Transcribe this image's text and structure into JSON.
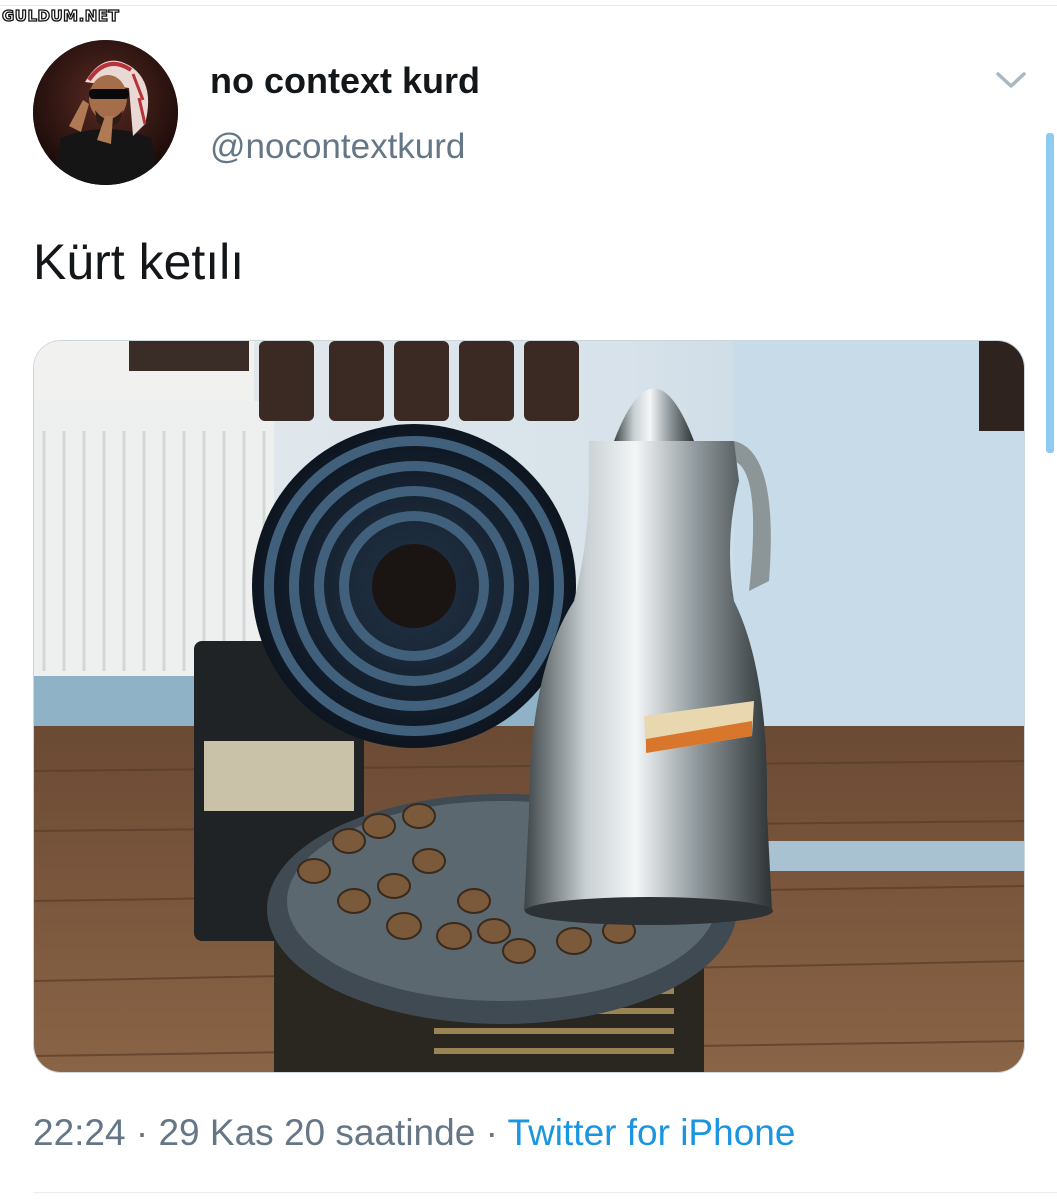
{
  "watermark": "GULDUM.NET",
  "tweet": {
    "display_name": "no context kurd",
    "handle": "@nocontextkurd",
    "text": "Kürt ketılı",
    "time": "22:24",
    "date": "29 Kas 20 saatinde",
    "separator": "·",
    "source": "Twitter for iPhone"
  },
  "icons": {
    "more": "chevron-down-icon"
  },
  "colors": {
    "link": "#1b95e0",
    "secondary_text": "#657786",
    "primary_text": "#14171a"
  }
}
